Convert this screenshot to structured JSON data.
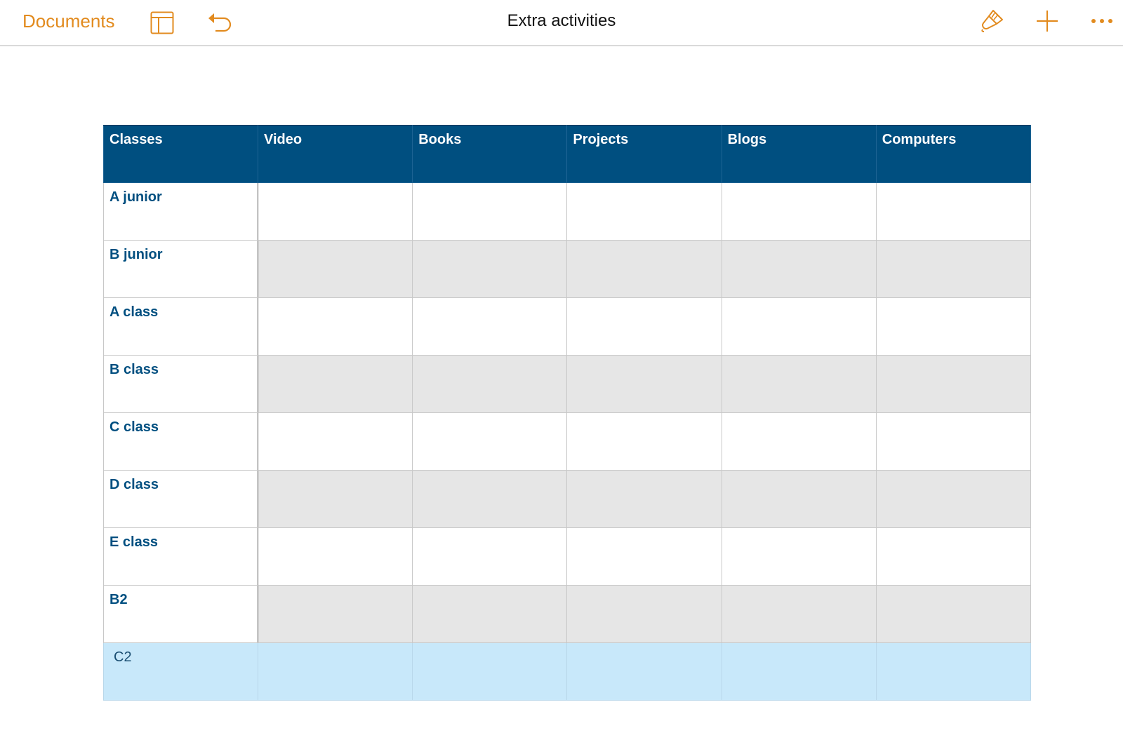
{
  "toolbar": {
    "back_label": "Documents",
    "title": "Extra activities",
    "accent_color": "#e28b1f",
    "icons": {
      "sidebar": "sidebar-icon",
      "undo": "undo-icon",
      "format": "paintbrush-icon",
      "add": "plus-icon",
      "more": "more-icon"
    }
  },
  "table": {
    "header_color": "#004f80",
    "columns": [
      "Classes",
      "Video",
      "Books",
      "Projects",
      "Blogs",
      "Computers"
    ],
    "rows": [
      {
        "label": "A junior",
        "cells": [
          "",
          "",
          "",
          "",
          ""
        ]
      },
      {
        "label": "B junior",
        "cells": [
          "",
          "",
          "",
          "",
          ""
        ]
      },
      {
        "label": "A class",
        "cells": [
          "",
          "",
          "",
          "",
          ""
        ]
      },
      {
        "label": "B class",
        "cells": [
          "",
          "",
          "",
          "",
          ""
        ]
      },
      {
        "label": "C class",
        "cells": [
          "",
          "",
          "",
          "",
          ""
        ]
      },
      {
        "label": "D class",
        "cells": [
          "",
          "",
          "",
          "",
          ""
        ]
      },
      {
        "label": "E class",
        "cells": [
          "",
          "",
          "",
          "",
          ""
        ]
      },
      {
        "label": "B2",
        "cells": [
          "",
          "",
          "",
          "",
          ""
        ]
      },
      {
        "label": "C2",
        "cells": [
          "",
          "",
          "",
          "",
          ""
        ],
        "selected": true
      }
    ]
  }
}
